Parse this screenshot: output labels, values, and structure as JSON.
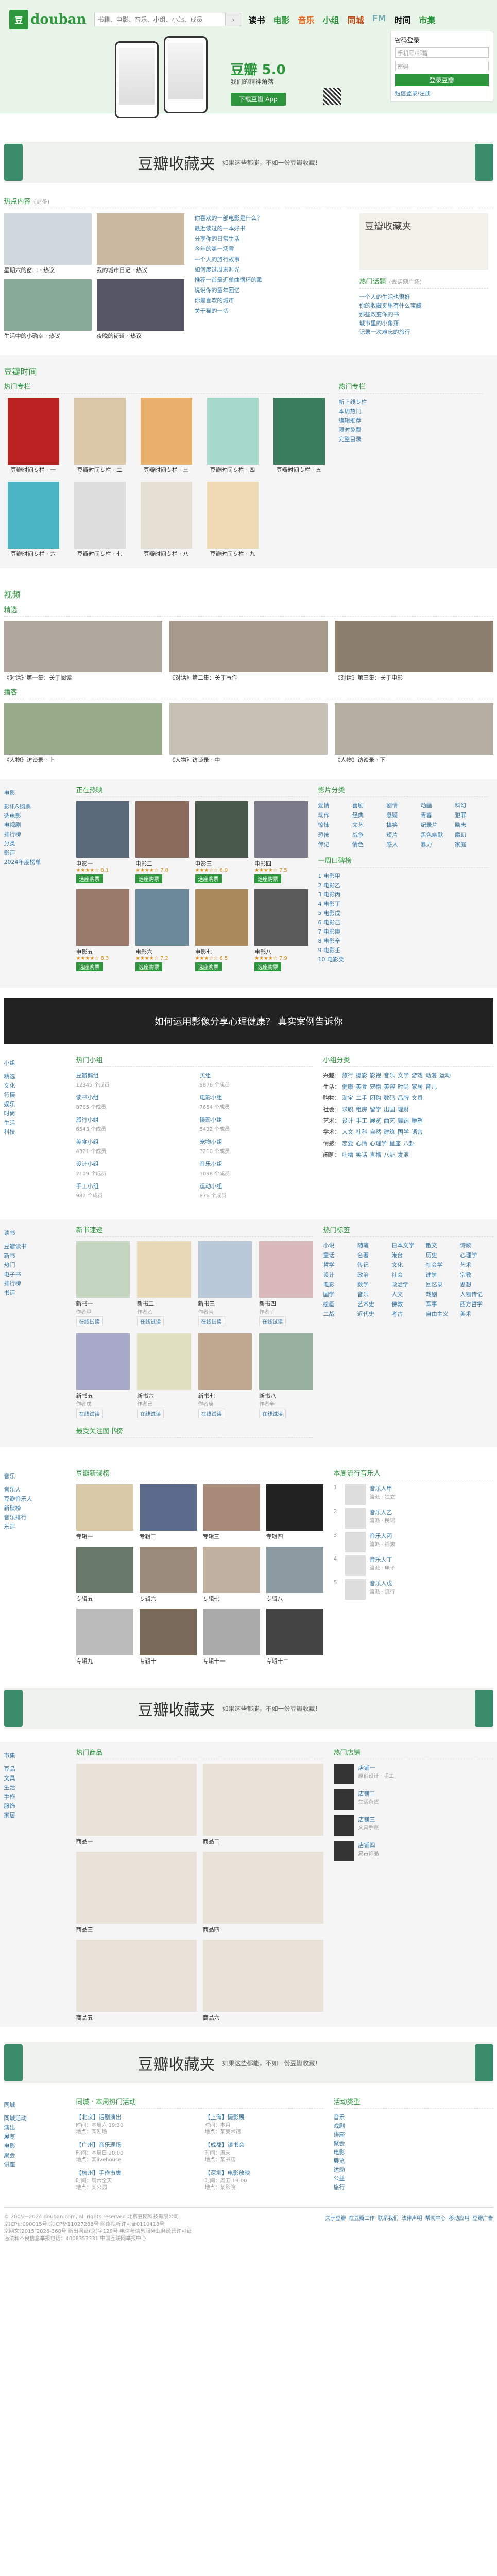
{
  "header": {
    "logo_mark": "豆",
    "logo_word": "douban",
    "search_placeholder": "书籍、电影、音乐、小组、小站、成员",
    "nav": [
      "读书",
      "电影",
      "音乐",
      "小组",
      "同城",
      "FM",
      "时间",
      "市集"
    ],
    "app_title": "豆瓣 5.0",
    "app_sub": "我们的精神角落",
    "app_btn": "下载豆瓣 App",
    "login_title": "密码登录",
    "login_user": "手机号/邮箱",
    "login_pass": "密码",
    "login_btn": "登录豆瓣",
    "login_link": "短信登录/注册"
  },
  "banner": {
    "title": "豆瓣收藏夹",
    "sub": "如果这些都能，不如一份豆瓣收藏！"
  },
  "hot": {
    "title": "热点内容",
    "more": "(更多)",
    "img_caps": [
      "星期六的窗口 · 热议",
      "我的城市日记 · 热议",
      "生活中的小确幸 · 热议",
      "夜晚的街道 · 热议"
    ],
    "list": [
      "你喜欢的一部电影是什么？",
      "最近读过的一本好书",
      "分享你的日常生活",
      "今年的第一场雪",
      "一个人的旅行故事",
      "如何度过周末时光",
      "推荐一首最近单曲循环的歌",
      "说说你的童年回忆",
      "你最喜欢的城市",
      "关于猫的一切"
    ],
    "side_title": "热门话题",
    "side_more": "(去话题广场)",
    "side_list": [
      "一个人的生活也很好",
      "你的收藏夹里有什么宝藏",
      "那些改变你的书",
      "城市里的小角落",
      "记录一次难忘的旅行"
    ]
  },
  "time": {
    "title": "豆瓣时间",
    "hot_label": "热门专栏",
    "books": [
      "豆瓣时间专栏 · 一",
      "豆瓣时间专栏 · 二",
      "豆瓣时间专栏 · 三",
      "豆瓣时间专栏 · 四",
      "豆瓣时间专栏 · 五",
      "豆瓣时间专栏 · 六",
      "豆瓣时间专栏 · 七",
      "豆瓣时间专栏 · 八",
      "豆瓣时间专栏 · 九"
    ],
    "side_title": "热门专栏",
    "side_list": [
      "新上线专栏",
      "本周热门",
      "编辑推荐",
      "限时免费",
      "完整目录"
    ]
  },
  "video": {
    "title": "视频",
    "label_a": "精选",
    "label_b": "播客",
    "vids": [
      "《对话》第一集：关于阅读",
      "《对话》第二集：关于写作",
      "《对话》第三集：关于电影",
      "《人物》访谈录 · 上",
      "《人物》访谈录 · 中",
      "《人物》访谈录 · 下"
    ]
  },
  "movie": {
    "title": "电影",
    "nav": [
      "影讯&购票",
      "选电影",
      "电视剧",
      "排行榜",
      "分类",
      "影评",
      "2024年度榜单"
    ],
    "hot_label": "正在热映",
    "posters": [
      {
        "t": "电影一",
        "s": "★★★★☆ 8.1",
        "b": "选座购票"
      },
      {
        "t": "电影二",
        "s": "★★★★☆ 7.8",
        "b": "选座购票"
      },
      {
        "t": "电影三",
        "s": "★★★☆☆ 6.9",
        "b": "选座购票"
      },
      {
        "t": "电影四",
        "s": "★★★★☆ 7.5",
        "b": "选座购票"
      },
      {
        "t": "电影五",
        "s": "★★★★☆ 8.3",
        "b": "选座购票"
      },
      {
        "t": "电影六",
        "s": "★★★★☆ 7.2",
        "b": "选座购票"
      },
      {
        "t": "电影七",
        "s": "★★★☆☆ 6.5",
        "b": "选座购票"
      },
      {
        "t": "电影八",
        "s": "★★★★☆ 7.9",
        "b": "选座购票"
      }
    ],
    "tag_title": "影片分类",
    "tags": [
      "爱情",
      "喜剧",
      "剧情",
      "动画",
      "科幻",
      "动作",
      "经典",
      "悬疑",
      "青春",
      "犯罪",
      "惊悚",
      "文艺",
      "搞笑",
      "纪录片",
      "励志",
      "恐怖",
      "战争",
      "短片",
      "黑色幽默",
      "魔幻",
      "传记",
      "情色",
      "感人",
      "暴力",
      "家庭"
    ],
    "rank_title": "一周口碑榜",
    "rank": [
      "1 电影甲",
      "2 电影乙",
      "3 电影丙",
      "4 电影丁",
      "5 电影戊",
      "6 电影己",
      "7 电影庚",
      "8 电影辛",
      "9 电影壬",
      "10 电影癸"
    ],
    "banner": "如何运用影像分享心理健康？ 真实案例告诉你"
  },
  "group": {
    "title": "小组",
    "nav": [
      "精选",
      "文化",
      "行摄",
      "娱乐",
      "时尚",
      "生活",
      "科技"
    ],
    "hot_label": "热门小组",
    "items": [
      {
        "a": "豆瓣鹅组",
        "b": "12345 个成员"
      },
      {
        "a": "买组",
        "b": "9876 个成员"
      },
      {
        "a": "读书小组",
        "b": "8765 个成员"
      },
      {
        "a": "电影小组",
        "b": "7654 个成员"
      },
      {
        "a": "旅行小组",
        "b": "6543 个成员"
      },
      {
        "a": "摄影小组",
        "b": "5432 个成员"
      },
      {
        "a": "美食小组",
        "b": "4321 个成员"
      },
      {
        "a": "宠物小组",
        "b": "3210 个成员"
      },
      {
        "a": "设计小组",
        "b": "2109 个成员"
      },
      {
        "a": "音乐小组",
        "b": "1098 个成员"
      },
      {
        "a": "手工小组",
        "b": "987 个成员"
      },
      {
        "a": "运动小组",
        "b": "876 个成员"
      }
    ],
    "cat_title": "小组分类",
    "cats": [
      {
        "n": "兴趣",
        "v": [
          "旅行",
          "摄影",
          "影视",
          "音乐",
          "文学",
          "游戏",
          "动漫",
          "运动"
        ]
      },
      {
        "n": "生活",
        "v": [
          "健康",
          "美食",
          "宠物",
          "美容",
          "时尚",
          "家居",
          "育儿"
        ]
      },
      {
        "n": "购物",
        "v": [
          "淘宝",
          "二手",
          "团购",
          "数码",
          "品牌",
          "文具"
        ]
      },
      {
        "n": "社会",
        "v": [
          "求职",
          "租房",
          "留学",
          "出国",
          "理财"
        ]
      },
      {
        "n": "艺术",
        "v": [
          "设计",
          "手工",
          "展览",
          "曲艺",
          "舞蹈",
          "雕塑"
        ]
      },
      {
        "n": "学术",
        "v": [
          "人文",
          "社科",
          "自然",
          "建筑",
          "国学",
          "语言"
        ]
      },
      {
        "n": "情感",
        "v": [
          "恋爱",
          "心情",
          "心理学",
          "星座",
          "八卦"
        ]
      },
      {
        "n": "闲聊",
        "v": [
          "吐槽",
          "笑话",
          "直播",
          "八卦",
          "发泄"
        ]
      }
    ]
  },
  "read": {
    "title": "读书",
    "nav": [
      "豆瓣读书",
      "新书",
      "热门",
      "电子书",
      "排行榜",
      "书评"
    ],
    "hot_label": "新书速递",
    "books": [
      {
        "t": "新书一",
        "s": "作者甲",
        "b": "在线试读"
      },
      {
        "t": "新书二",
        "s": "作者乙",
        "b": "在线试读"
      },
      {
        "t": "新书三",
        "s": "作者丙",
        "b": "在线试读"
      },
      {
        "t": "新书四",
        "s": "作者丁",
        "b": "在线试读"
      },
      {
        "t": "新书五",
        "s": "作者戊",
        "b": "在线试读"
      },
      {
        "t": "新书六",
        "s": "作者己",
        "b": "在线试读"
      },
      {
        "t": "新书七",
        "s": "作者庚",
        "b": "在线试读"
      },
      {
        "t": "新书八",
        "s": "作者辛",
        "b": "在线试读"
      }
    ],
    "tag_title": "热门标签",
    "tags": [
      "小说",
      "随笔",
      "日本文学",
      "散文",
      "诗歌",
      "童话",
      "名著",
      "港台",
      "历史",
      "心理学",
      "哲学",
      "传记",
      "文化",
      "社会学",
      "艺术",
      "设计",
      "政治",
      "社会",
      "建筑",
      "宗教",
      "电影",
      "数学",
      "政治学",
      "回忆录",
      "思想",
      "国学",
      "音乐",
      "人文",
      "戏剧",
      "人物传记",
      "绘画",
      "艺术史",
      "佛教",
      "军事",
      "西方哲学",
      "二战",
      "近代史",
      "考古",
      "自由主义",
      "美术"
    ],
    "extra_title": "最受关注图书榜"
  },
  "music": {
    "title": "音乐",
    "nav": [
      "音乐人",
      "豆瓣音乐人",
      "新碟榜",
      "音乐排行",
      "乐评"
    ],
    "hot_label": "豆瓣新碟榜",
    "albums": [
      {
        "t": "专辑一"
      },
      {
        "t": "专辑二"
      },
      {
        "t": "专辑三"
      },
      {
        "t": "专辑四"
      },
      {
        "t": "专辑五"
      },
      {
        "t": "专辑六"
      },
      {
        "t": "专辑七"
      },
      {
        "t": "专辑八"
      },
      {
        "t": "专辑九"
      },
      {
        "t": "专辑十"
      },
      {
        "t": "专辑十一"
      },
      {
        "t": "专辑十二"
      }
    ],
    "chart_title": "本周流行音乐人",
    "chart": [
      {
        "t": "音乐人甲",
        "s": "流派 · 独立"
      },
      {
        "t": "音乐人乙",
        "s": "流派 · 民谣"
      },
      {
        "t": "音乐人丙",
        "s": "流派 · 摇滚"
      },
      {
        "t": "音乐人丁",
        "s": "流派 · 电子"
      },
      {
        "t": "音乐人戊",
        "s": "流派 · 流行"
      }
    ]
  },
  "market": {
    "title": "市集",
    "nav": [
      "豆品",
      "文具",
      "生活",
      "手作",
      "服饰",
      "家居"
    ],
    "hot_label": "热门商品",
    "goods": [
      {
        "t": "商品一"
      },
      {
        "t": "商品二"
      },
      {
        "t": "商品三"
      },
      {
        "t": "商品四"
      },
      {
        "t": "商品五"
      },
      {
        "t": "商品六"
      }
    ],
    "shop_title": "热门店铺",
    "shops": [
      {
        "t": "店铺一",
        "d": "原创设计 · 手工"
      },
      {
        "t": "店铺二",
        "d": "生活杂货"
      },
      {
        "t": "店铺三",
        "d": "文具手账"
      },
      {
        "t": "店铺四",
        "d": "复古饰品"
      }
    ]
  },
  "event": {
    "title": "同城",
    "nav": [
      "同城活动",
      "演出",
      "展览",
      "电影",
      "聚会",
      "讲座"
    ],
    "hot_label": "同城 · 本周热门活动",
    "items": [
      {
        "t": "【北京】话剧演出",
        "d": "时间：本周六 19:30\n地点：某剧场"
      },
      {
        "t": "【上海】摄影展",
        "d": "时间：本月\n地点：某美术馆"
      },
      {
        "t": "【广州】音乐现场",
        "d": "时间：本周日 20:00\n地点：某livehouse"
      },
      {
        "t": "【成都】读书会",
        "d": "时间：周末\n地点：某书店"
      },
      {
        "t": "【杭州】手作市集",
        "d": "时间：周六全天\n地点：某公园"
      },
      {
        "t": "【深圳】电影放映",
        "d": "时间：周五 19:00\n地点：某影院"
      }
    ],
    "side_title": "活动类型",
    "side_list": [
      "音乐",
      "戏剧",
      "讲座",
      "聚会",
      "电影",
      "展览",
      "运动",
      "公益",
      "旅行"
    ]
  },
  "footer": {
    "left": [
      "© 2005－2024 douban.com, all rights reserved 北京豆网科技有限公司",
      "京ICP证090015号 京ICP备11027288号 网络视听许可证0110418号",
      "京网文[2015]2026-368号 新出网证(京)字129号 电信与信息服务业务经营许可证",
      "违法和不良信息举报电话：4008353331 中国互联网举报中心"
    ],
    "right": [
      "关于豆瓣",
      "在豆瓣工作",
      "联系我们",
      "法律声明",
      "帮助中心",
      "移动应用",
      "豆瓣广告"
    ]
  }
}
